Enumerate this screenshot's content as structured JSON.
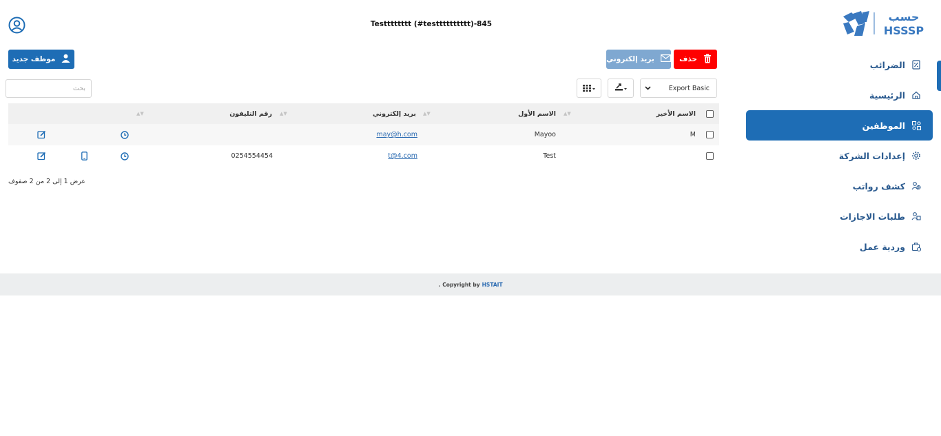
{
  "header": {
    "logo_text": "HSSSP",
    "logo_arabic": "حسب",
    "company_title": "Testttttttt (#testttttttttt)-845",
    "user_icon": "user-circle-icon"
  },
  "sidebar": {
    "items": [
      {
        "label": "الضرائب",
        "icon": "tax-document-icon"
      },
      {
        "label": "الرئيسية",
        "icon": "home-icon"
      },
      {
        "label": "الموظفين",
        "icon": "employees-icon",
        "active": true
      },
      {
        "label": "إعدادات الشركة",
        "icon": "gear-icon"
      },
      {
        "label": "كشف رواتب",
        "icon": "payroll-icon"
      },
      {
        "label": "طلبات الاجازات",
        "icon": "leave-requests-icon"
      },
      {
        "label": "وردية عمل",
        "icon": "work-shift-icon"
      }
    ]
  },
  "toolbar": {
    "delete_label": "حذف",
    "email_label": "بريد إلكتروني",
    "new_employee_label": "موظف جديد",
    "export_value": "Export Basic",
    "search_placeholder": "بحث"
  },
  "table": {
    "headers": {
      "last_name": "الاسم الأخير",
      "first_name": "الاسم الأول",
      "email": "بريد إلكتروني",
      "phone": "رقم التليفون"
    },
    "rows": [
      {
        "last_name": "M",
        "first_name": "Mayoo",
        "email": "may@h.com",
        "phone": "",
        "has_mobile": false
      },
      {
        "last_name": "",
        "first_name": "Test",
        "email": "t@4.com",
        "phone": "0254554454",
        "has_mobile": true
      }
    ],
    "summary": "عرض 1 إلى 2 من 2 صفوف"
  },
  "footer": {
    "prefix": "Copyright by",
    "brand": "HSTAIT",
    "suffix": "."
  },
  "colors": {
    "primary": "#1e6db5",
    "danger": "#ff0000",
    "email_button": "#7fa8d1",
    "link": "#2a6ab1"
  }
}
